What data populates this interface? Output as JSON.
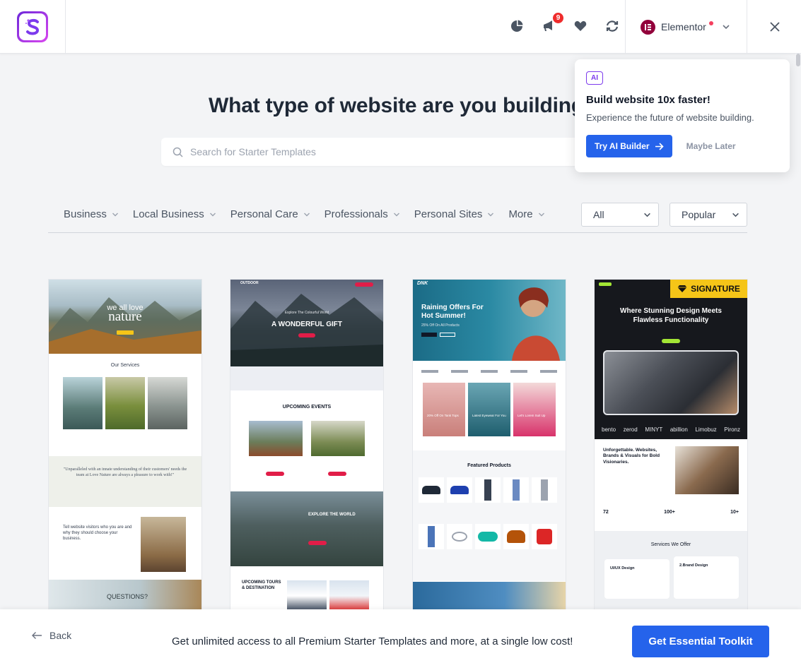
{
  "header": {
    "notification_count": "9",
    "builder": {
      "name": "Elementor"
    }
  },
  "main": {
    "title": "What type of website are you building",
    "search": {
      "placeholder": "Search for Starter Templates",
      "value": ""
    }
  },
  "ai_popup": {
    "badge": "AI",
    "title": "Build website 10x faster!",
    "subtitle": "Experience the future of website building.",
    "primary": "Try AI Builder",
    "secondary": "Maybe Later"
  },
  "filters": {
    "categories": [
      "Business",
      "Local Business",
      "Personal Care",
      "Professionals",
      "Personal Sites",
      "More"
    ],
    "type": {
      "selected": "All"
    },
    "sort": {
      "selected": "Popular"
    }
  },
  "templates": [
    {
      "hero_line1": "we all love",
      "hero_line2": "nature",
      "section_title": "Our Services",
      "quote": "\"Unparalleled with an innate understanding of their customers' needs the team at Love Nature are always a pleasure to work with!\"",
      "about_text": "Tell website visitors who you are and why they should choose your business.",
      "bottom_title": "QUESTIONS?"
    },
    {
      "brand": "OUTDOOR",
      "hero_kicker": "Explore The Colourful World",
      "hero_title": "A WONDERFUL GIFT",
      "events_title": "UPCOMING EVENTS",
      "explore_title": "EXPLORE THE WORLD",
      "tours_title": "UPCOMING TOURS & DESTINATION"
    },
    {
      "brand": "DNK",
      "hero_title": "Raining Offers For Hot Summer!",
      "hero_sub": "25% Off On All Products",
      "promo1": "20% Off On Tank Tops",
      "promo2": "Latest Eyewear For You",
      "promo3": "Let's Lorem Suit Up",
      "section_title": "Featured Products"
    },
    {
      "badge": "SIGNATURE",
      "hero_title": "Where Stunning Design Meets Flawless Functionality",
      "logos": [
        "bento",
        "zerod",
        "MINYT",
        "abillion",
        "Limobuz",
        "Pironz"
      ],
      "headline": "Unforgettable. Websites, Brands & Visuals for Bold Visionaries.",
      "stats": [
        "72",
        "100+",
        "10+"
      ],
      "services_title": "Services We Offer",
      "service1": "UI/UX Design",
      "service2": "2.Brand Design"
    }
  ],
  "footer": {
    "back": "Back",
    "promo": "Get unlimited access to all Premium Starter Templates and more, at a single low cost!",
    "cta": "Get Essential Toolkit"
  },
  "colors": {
    "accent": "#2563eb",
    "brand_gradient": [
      "#6d28d9",
      "#d946ef"
    ],
    "badge": "#ef2c2c",
    "signature": "#f5c518"
  }
}
